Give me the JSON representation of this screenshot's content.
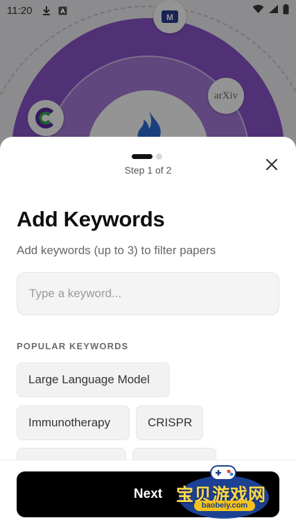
{
  "status_bar": {
    "time": "11:20",
    "icons_left": [
      "download-icon",
      "text-a-icon"
    ],
    "icons_right": [
      "wifi-icon",
      "cellular-icon",
      "battery-icon"
    ]
  },
  "background": {
    "logos": [
      "lm-logo",
      "arxiv-logo",
      "c-logo",
      "flame-logo"
    ],
    "arxiv_text": "arXiv",
    "colors": {
      "ring_outer": "#8b55cc",
      "ring_mid": "#a57ad8"
    }
  },
  "sheet": {
    "step_text": "Step 1 of 2",
    "title": "Add Keywords",
    "subtitle": "Add keywords (up to 3) to filter papers",
    "input": {
      "value": "",
      "placeholder": "Type a keyword..."
    },
    "section_label": "POPULAR KEYWORDS",
    "chips": [
      "Large Language Model",
      "Immunotherapy",
      "CRISPR",
      "",
      ""
    ],
    "next_label": "Next"
  },
  "watermark": {
    "text": "宝贝游戏网",
    "url": "baobeiy.com"
  }
}
